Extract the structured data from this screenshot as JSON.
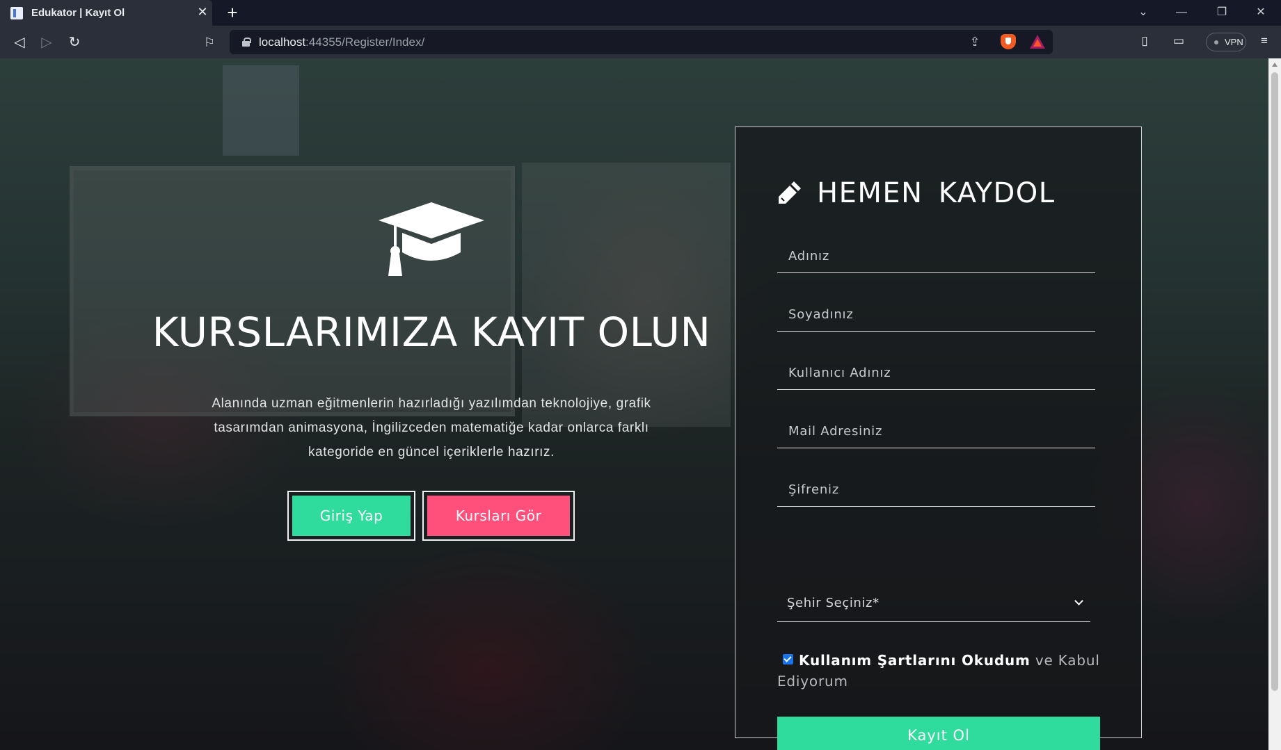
{
  "browser": {
    "tab_title": "Edukator | Kayıt Ol",
    "url_host": "localhost",
    "url_path": ":44355/Register/Index/",
    "vpn_label": "VPN"
  },
  "hero": {
    "title": "KURSLARIMIZA KAYIT OLUN",
    "description": "Alanında uzman eğitmenlerin hazırladığı yazılımdan teknolojiye, grafik tasarımdan animasyona, İngilizceden matematiğe kadar onlarca farklı kategoride en güncel içeriklerle hazırız.",
    "login_label": "Giriş Yap",
    "courses_label": "Kursları Gör"
  },
  "register": {
    "title": "HEMEN KAYDOL",
    "fields": {
      "first_name": "Adınız",
      "last_name": "Soyadınız",
      "username": "Kullanıcı Adınız",
      "email": "Mail Adresiniz",
      "password": "Şifreniz"
    },
    "city_select": "Şehir Seçiniz*",
    "terms_strong": "Kullanım Şartlarını Okudum",
    "terms_rest": " ve Kabul Ediyorum",
    "terms_checked": true,
    "submit_label": "Kayıt Ol"
  },
  "colors": {
    "accent_green": "#2fdc9d",
    "accent_pink": "#ff4f7b"
  },
  "icons": [
    "graduation-cap-icon",
    "pencil-icon",
    "chevron-down-icon",
    "lock-icon",
    "bookmark-icon",
    "reload-icon",
    "back-icon",
    "forward-icon",
    "share-icon",
    "brave-shields-icon",
    "brave-rewards-icon",
    "sidebar-icon",
    "wallet-icon",
    "menu-icon"
  ]
}
